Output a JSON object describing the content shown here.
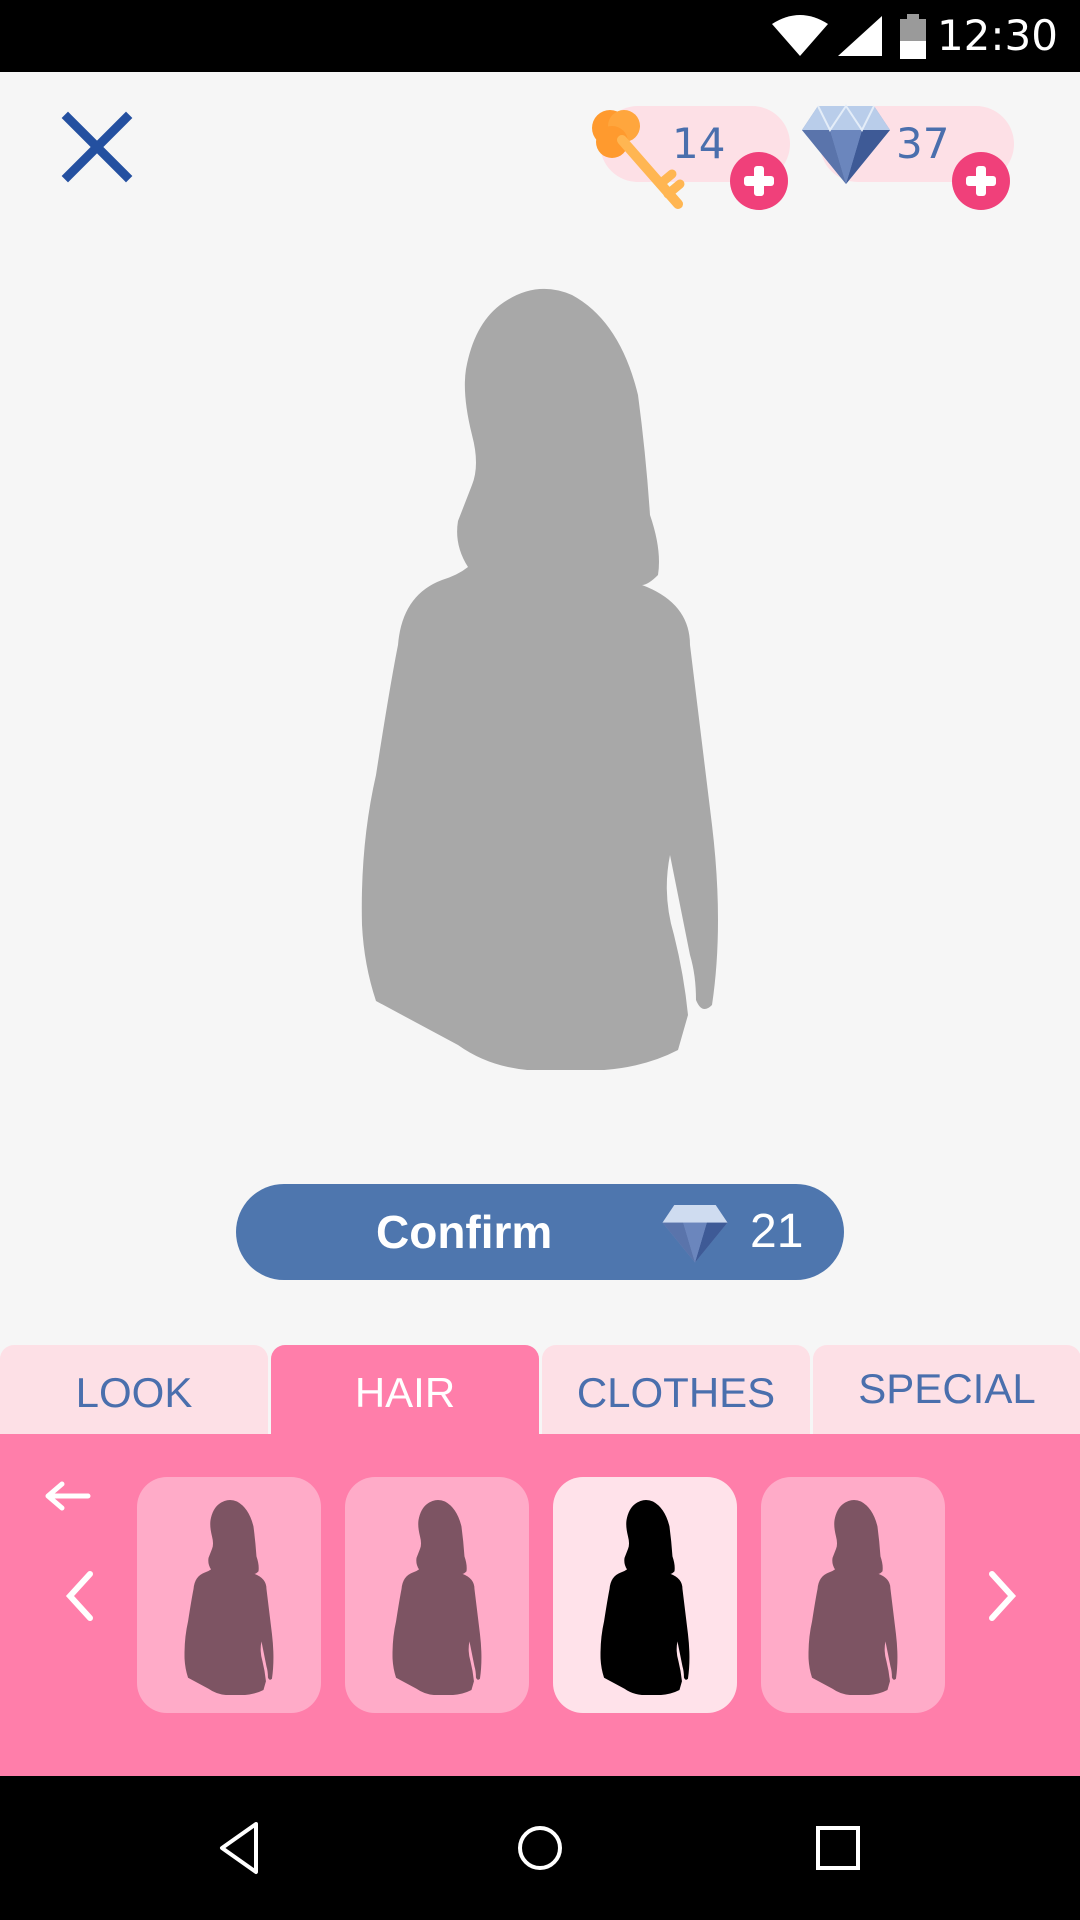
{
  "status_bar": {
    "time": "12:30",
    "icons": [
      "wifi-icon",
      "signal-icon",
      "battery-icon"
    ]
  },
  "header": {
    "close_icon": "close-icon",
    "keys": {
      "icon": "key-icon",
      "amount": "14"
    },
    "gems": {
      "icon": "diamond-icon",
      "amount": "37"
    }
  },
  "confirm": {
    "label": "Confirm",
    "cost": "21",
    "cost_icon": "diamond-icon"
  },
  "tabs": [
    {
      "label": "LOOK",
      "active": false
    },
    {
      "label": "HAIR",
      "active": true
    },
    {
      "label": "CLOTHES",
      "active": false
    },
    {
      "label": "SPECIAL",
      "active": false
    }
  ],
  "options": {
    "selected_index": 2,
    "count": 4
  },
  "nav_bar": {
    "icons": [
      "back-icon",
      "home-icon",
      "recents-icon"
    ]
  },
  "colors": {
    "accent_pink": "#ff7eaa",
    "tab_pink": "#fde0e6",
    "confirm_blue": "#4e76ae",
    "plus_pink": "#f0407a",
    "text_blue": "#4a6fad"
  }
}
